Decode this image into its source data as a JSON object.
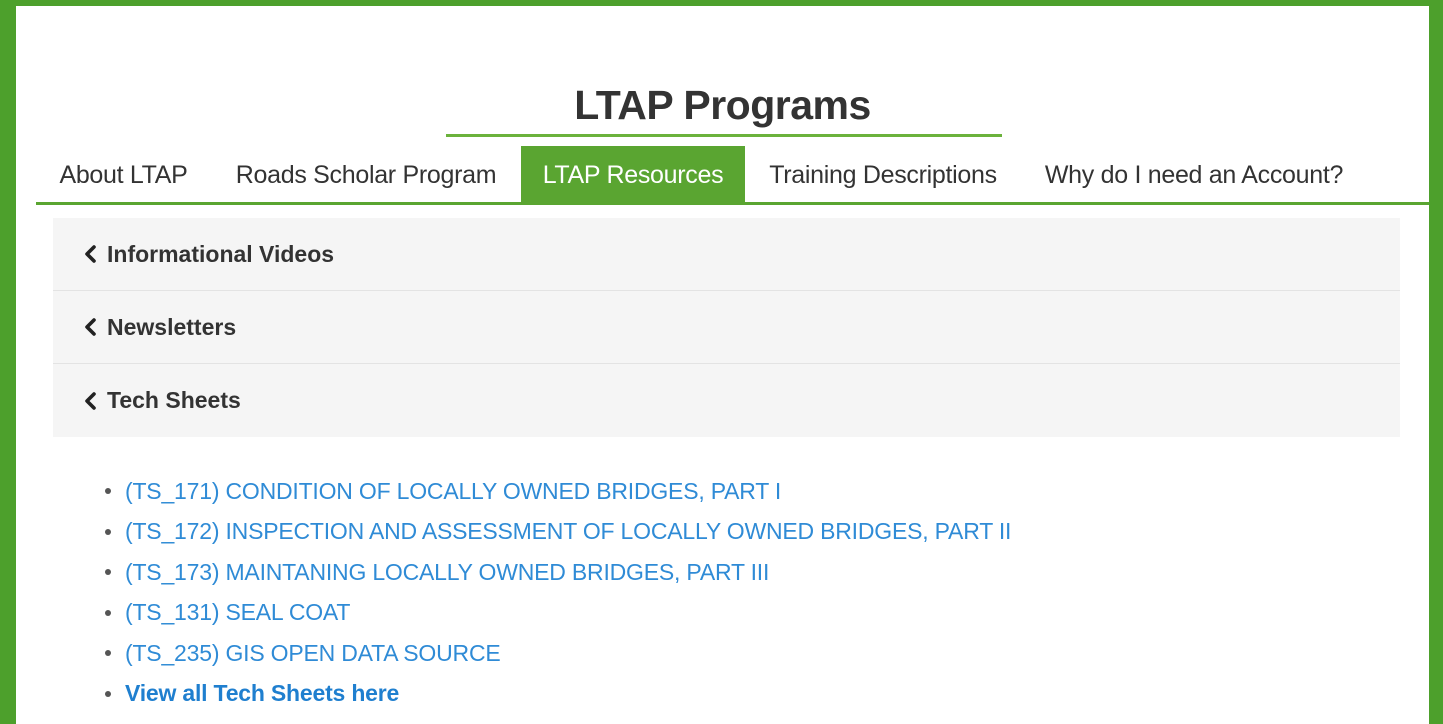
{
  "page": {
    "title": "LTAP Programs",
    "accent_color": "#5aa531",
    "link_color": "#2f8bd6"
  },
  "tabs": [
    {
      "label": "About LTAP",
      "active": false
    },
    {
      "label": "Roads Scholar Program",
      "active": false
    },
    {
      "label": "LTAP Resources",
      "active": true
    },
    {
      "label": "Training Descriptions",
      "active": false
    },
    {
      "label": "Why do I need an Account?",
      "active": false
    }
  ],
  "accordion": {
    "icon": "chevron-left-icon",
    "items": [
      {
        "label": "Informational Videos"
      },
      {
        "label": "Newsletters"
      },
      {
        "label": "Tech Sheets"
      }
    ]
  },
  "tech_sheets": {
    "items": [
      {
        "label": "(TS_171) CONDITION OF LOCALLY OWNED BRIDGES, PART I"
      },
      {
        "label": "(TS_172) INSPECTION AND ASSESSMENT OF LOCALLY OWNED BRIDGES, PART II"
      },
      {
        "label": "(TS_173) MAINTANING LOCALLY OWNED BRIDGES, PART III"
      },
      {
        "label": "(TS_131) SEAL COAT"
      },
      {
        "label": "(TS_235) GIS OPEN DATA SOURCE"
      }
    ],
    "view_all_label": "View all Tech Sheets here"
  }
}
